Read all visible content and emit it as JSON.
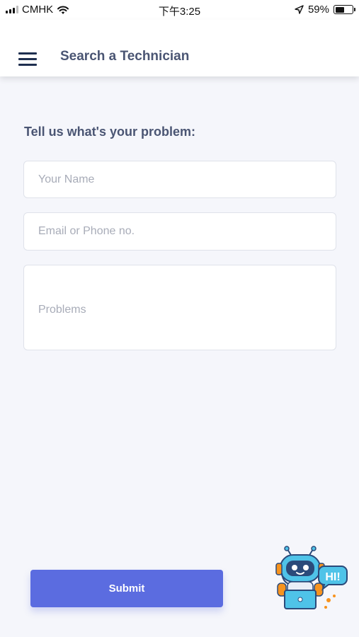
{
  "status_bar": {
    "carrier": "CMHK",
    "time": "下午3:25",
    "battery_percent": "59%",
    "battery_level": 0.59,
    "icons": [
      "signal-icon",
      "wifi-icon",
      "location-arrow-icon",
      "battery-icon"
    ]
  },
  "header": {
    "title": "Search a Technician",
    "menu_icon": "hamburger-menu-icon"
  },
  "form": {
    "title": "Tell us what's your problem:",
    "name_placeholder": "Your Name",
    "name_value": "",
    "contact_placeholder": "Email or Phone no.",
    "contact_value": "",
    "problem_placeholder": "Problems",
    "problem_value": "",
    "submit_label": "Submit"
  },
  "chatbot": {
    "icon": "robot-chat-icon",
    "bubble_text": "HI!"
  },
  "colors": {
    "accent": "#5b6ce0",
    "header_text": "#4a5573",
    "background": "#f5f6fb",
    "bot_blue": "#4fc3e8",
    "bot_orange": "#f7931e"
  }
}
